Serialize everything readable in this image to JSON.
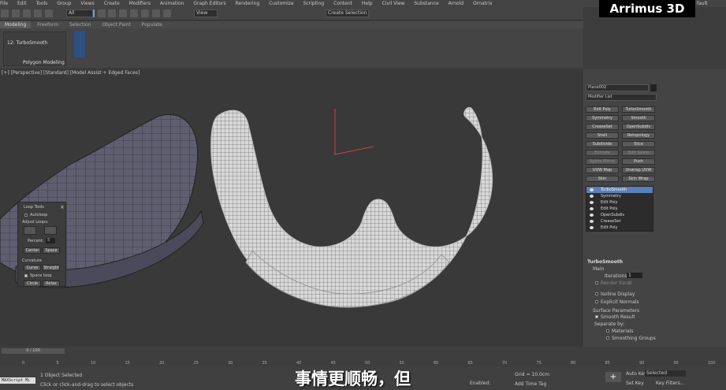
{
  "menu": [
    "File",
    "Edit",
    "Tools",
    "Group",
    "Views",
    "Create",
    "Modifiers",
    "Animation",
    "Graph Editors",
    "Rendering",
    "Customize",
    "Scripting",
    "Content",
    "Help",
    "Civil View",
    "Substance",
    "Arnold",
    "Ornatrix"
  ],
  "toolbar": {
    "filter": "All",
    "view": "View",
    "selection_set": "Create Selection Se"
  },
  "workspace": "fault",
  "logo": "Arrimus 3D",
  "ribbon": {
    "tabs": [
      "Modeling",
      "Freeform",
      "Selection",
      "Object Paint",
      "Populate"
    ],
    "modifier_label": "12: TurboSmooth",
    "group_label": "Polygon Modeling"
  },
  "viewport": {
    "label": "[+] [Perspective] [Standard] [Model Assist + Edged Faces]"
  },
  "looptools": {
    "title": "Loop Tools",
    "autoloop": "Autoloop",
    "adjust": "Adjust Loops:",
    "percent_label": "Percent:",
    "percent_value": "5",
    "center": "Center",
    "space": "Space",
    "curvature": "Curvature",
    "curve": "Curve",
    "straight": "Straight",
    "spaceloop": "Space loop",
    "circle": "Circle",
    "relax": "Relax"
  },
  "cmd": {
    "object_name": "Plane002",
    "modifier_list": "Modifier List",
    "buttons": [
      "Edit Poly",
      "TurboSmooth",
      "Symmetry",
      "Smooth",
      "CreaseSet",
      "OpenSubdiv",
      "Shell",
      "Retopology",
      "Subdivide",
      "Slice",
      "Extrude",
      "Edit Spline",
      "Spline Mirror",
      "Push",
      "UVW Map",
      "Unwrap UVW",
      "Skin",
      "Skin Wrap"
    ],
    "stack": [
      "TurboSmooth",
      "Symmetry",
      "Edit Poly",
      "Edit Poly",
      "OpenSubdiv",
      "CreaseSet",
      "Edit Poly"
    ],
    "rollout_title": "TurboSmooth",
    "main": "Main",
    "iterations_label": "Iterations:",
    "iterations": "1",
    "render_iters_label": "Render Iters:",
    "render_iters": "0",
    "isoline": "Isoline Display",
    "explicit": "Explicit Normals",
    "surface_params": "Surface Parameters",
    "smooth_result": "Smooth Result",
    "separate_by": "Separate by:",
    "materials": "Materials",
    "smoothing_groups": "Smoothing Groups"
  },
  "timeline": {
    "frame": "0 / 100",
    "ticks": [
      "0",
      "5",
      "10",
      "15",
      "20",
      "25",
      "30",
      "35",
      "40",
      "45",
      "50",
      "55",
      "60",
      "65",
      "70",
      "75",
      "80",
      "85",
      "90",
      "95",
      "100"
    ]
  },
  "status": {
    "script": "MAXScript Mi",
    "selected": "1 Object Selected",
    "hint": "Click or click-and-drag to select objects",
    "enabled": "Enabled:",
    "grid": "Grid = 10.0cm",
    "add_time_tag": "Add Time Tag",
    "auto_key": "Auto Key",
    "selected_dd": "Selected",
    "set_key": "Set Key",
    "key_filters": "Key Filters..."
  },
  "subtitle": "事情更顺畅，但"
}
